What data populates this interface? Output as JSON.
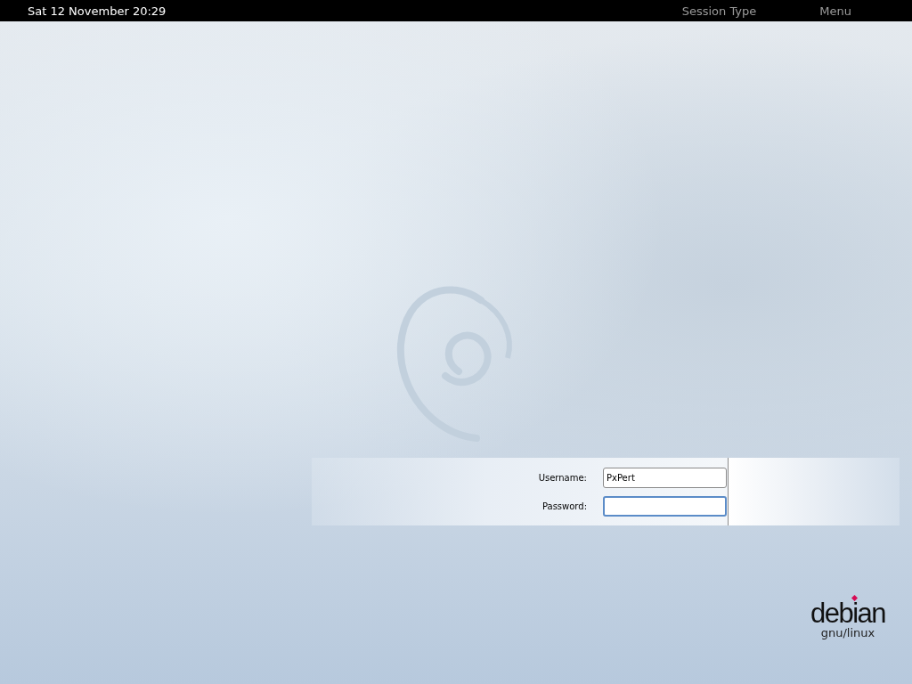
{
  "top_bar": {
    "clock": "Sat 12 November 20:29",
    "menus": [
      "Session Type",
      "Menu"
    ]
  },
  "login": {
    "fields": [
      {
        "label": "Username:",
        "value": "PxPert",
        "focused": false
      },
      {
        "label": "Password:",
        "focused": true
      }
    ]
  },
  "logo": {
    "name": "debian",
    "tagline": "gnu/linux"
  }
}
